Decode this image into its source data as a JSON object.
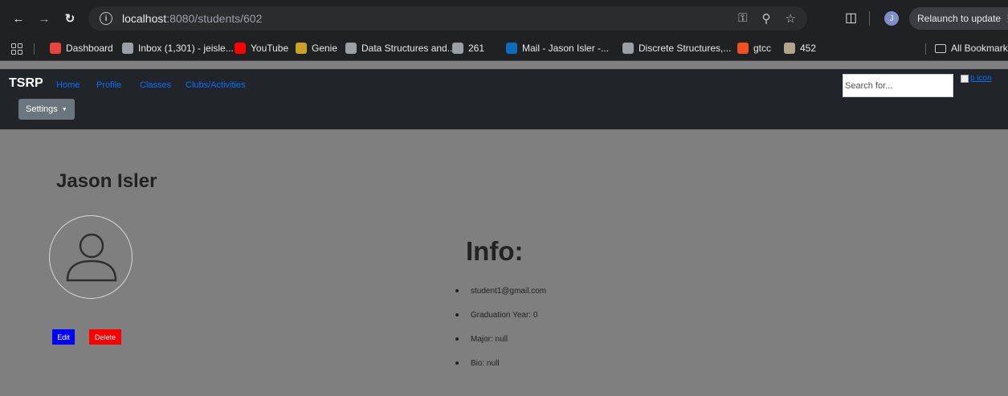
{
  "browser": {
    "url_host": "localhost",
    "url_path": ":8080/students/602",
    "relaunch_label": "Relaunch to update",
    "profile_initial": "J"
  },
  "bookmarks": [
    {
      "label": "Dashboard",
      "color": "#e8453c"
    },
    {
      "label": "Inbox (1,301) - jeisle...",
      "color": "#9aa0a6"
    },
    {
      "label": "YouTube",
      "color": "#ff0000"
    },
    {
      "label": "Genie",
      "color": "#c9a227"
    },
    {
      "label": "Data Structures and...",
      "color": "#9aa0a6"
    },
    {
      "label": "261",
      "color": "#9aa0a6"
    },
    {
      "label": "Mail - Jason Isler -...",
      "color": "#0f6cbd"
    },
    {
      "label": "Discrete Structures,...",
      "color": "#9aa0a6"
    },
    {
      "label": "gtcc",
      "color": "#f25022"
    },
    {
      "label": "452",
      "color": "#b0a58a"
    }
  ],
  "all_bookmarks_label": "All Bookmarks",
  "site": {
    "brand": "TSRP",
    "nav": [
      "Home",
      "Profile",
      "Classes",
      "Clubs/Activities"
    ],
    "settings_label": "Settings",
    "search_placeholder": "Search for...",
    "p_icon_label": "p icon"
  },
  "profile": {
    "name": "Jason Isler",
    "edit_label": "Edit",
    "delete_label": "Delete"
  },
  "info": {
    "title": "Info:",
    "items": [
      "student1@gmail.com",
      "Graduation Year: 0",
      "Major: null",
      "Bio: null"
    ]
  }
}
